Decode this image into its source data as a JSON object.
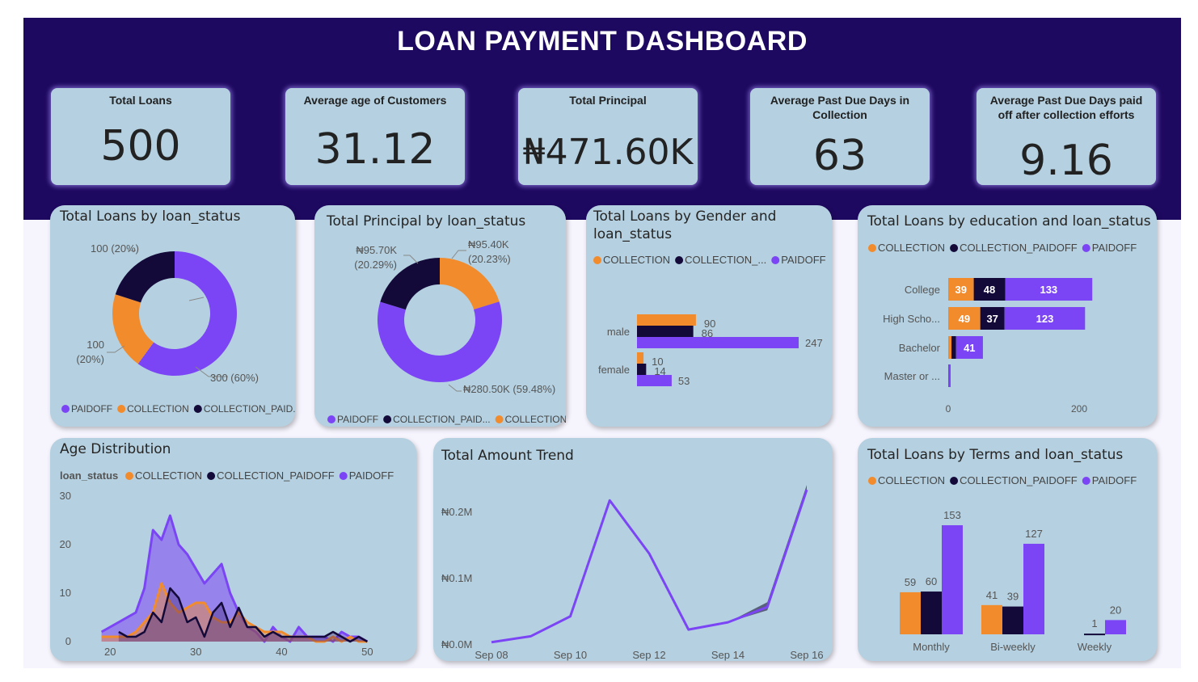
{
  "dashboard": {
    "title": "LOAN PAYMENT DASHBOARD"
  },
  "colors": {
    "paidoff": "#7b45f5",
    "collection": "#f28b2c",
    "collection_paidoff": "#130a3a",
    "card": "#b5d1e1",
    "header": "#1e0960"
  },
  "kpis": [
    {
      "label": "Total Loans",
      "value": "500"
    },
    {
      "label": "Average age of Customers",
      "value": "31.12"
    },
    {
      "label": "Total Principal",
      "value": "₦471.60K"
    },
    {
      "label": "Average Past Due Days in Collection",
      "value": "63"
    },
    {
      "label": "Average Past Due Days paid off after collection efforts",
      "value": "9.16"
    }
  ],
  "cards": {
    "loans_status": "Total Loans by loan_status",
    "principal_status": "Total Principal by loan_status",
    "gender": "Total Loans by Gender and loan_status",
    "education": "Total Loans by education and loan_status",
    "age": "Age Distribution",
    "trend": "Total Amount Trend",
    "terms": "Total Loans by Terms and loan_status"
  },
  "chart_data": [
    {
      "type": "pie",
      "title": "Total Loans by loan_status",
      "labels": [
        "PAIDOFF",
        "COLLECTION",
        "COLLECTION_PAIDOFF"
      ],
      "values": [
        300,
        100,
        100
      ],
      "data_labels": [
        "300 (60%)",
        "100",
        "(20%)",
        "100 (20%)"
      ],
      "legend": [
        "PAIDOFF",
        "COLLECTION",
        "COLLECTION_PAID..."
      ],
      "legend_position": "bottom"
    },
    {
      "type": "pie",
      "title": "Total Principal by loan_status",
      "labels": [
        "COLLECTION",
        "PAIDOFF",
        "COLLECTION_PAIDOFF"
      ],
      "values": [
        95400,
        280500,
        95700
      ],
      "data_labels": [
        "₦95.40K",
        "(20.23%)",
        "₦280.50K (59.48%)",
        "₦95.70K",
        "(20.29%)"
      ],
      "legend": [
        "PAIDOFF",
        "COLLECTION_PAID...",
        "COLLECTION"
      ],
      "legend_position": "bottom"
    },
    {
      "type": "bar",
      "orientation": "horizontal",
      "title": "Total Loans by Gender and loan_status",
      "legend": [
        "COLLECTION",
        "COLLECTION_...",
        "PAIDOFF"
      ],
      "legend_position": "top",
      "categories": [
        "male",
        "female"
      ],
      "series": [
        {
          "name": "COLLECTION",
          "values": [
            90,
            10
          ]
        },
        {
          "name": "COLLECTION_PAIDOFF",
          "values": [
            86,
            14
          ]
        },
        {
          "name": "PAIDOFF",
          "values": [
            247,
            53
          ]
        }
      ],
      "xlim": [
        0,
        260
      ]
    },
    {
      "type": "bar",
      "orientation": "horizontal",
      "stacked": true,
      "title": "Total Loans by education and loan_status",
      "legend": [
        "COLLECTION",
        "COLLECTION_PAIDOFF",
        "PAIDOFF"
      ],
      "legend_position": "top",
      "categories": [
        "College",
        "High Scho...",
        "Bachelor",
        "Master or ..."
      ],
      "series": [
        {
          "name": "COLLECTION",
          "values": [
            39,
            49,
            5,
            0
          ],
          "labels": [
            "39",
            "49",
            "",
            ""
          ]
        },
        {
          "name": "COLLECTION_PAIDOFF",
          "values": [
            48,
            37,
            7,
            0
          ],
          "labels": [
            "48",
            "37",
            "",
            ""
          ]
        },
        {
          "name": "PAIDOFF",
          "values": [
            133,
            123,
            41,
            2
          ],
          "labels": [
            "133",
            "123",
            "41",
            ""
          ]
        }
      ],
      "xticks": [
        "0",
        "200"
      ],
      "xlim": [
        0,
        260
      ]
    },
    {
      "type": "area",
      "title": "Age Distribution",
      "legend_title": "loan_status",
      "legend": [
        "COLLECTION",
        "COLLECTION_PAIDOFF",
        "PAIDOFF"
      ],
      "legend_position": "top-left",
      "xticks": [
        "20",
        "30",
        "40",
        "50"
      ],
      "yticks": [
        "0",
        "10",
        "20",
        "30"
      ],
      "xlim": [
        18,
        51
      ],
      "ylim": [
        0,
        30
      ],
      "series": [
        {
          "name": "PAIDOFF",
          "x": [
            19,
            21,
            23,
            24,
            25,
            26,
            27,
            28,
            29,
            30,
            31,
            32,
            33,
            34,
            35,
            36,
            37,
            38,
            39,
            40,
            41,
            42,
            43,
            44,
            45,
            46,
            47,
            48,
            49,
            50
          ],
          "y": [
            2,
            4,
            6,
            11,
            23,
            21,
            26,
            20,
            18,
            15,
            12,
            14,
            16,
            10,
            6,
            3,
            2,
            0,
            3,
            1,
            0,
            3,
            1,
            1,
            1,
            0,
            2,
            1,
            1,
            0
          ]
        },
        {
          "name": "COLLECTION",
          "x": [
            19,
            20,
            21,
            22,
            23,
            24,
            25,
            26,
            27,
            28,
            29,
            30,
            31,
            32,
            33,
            34,
            35,
            36,
            37,
            38,
            39,
            40,
            41,
            42,
            43,
            44,
            45,
            46,
            47,
            48,
            49,
            50
          ],
          "y": [
            1,
            1,
            1,
            1,
            2,
            4,
            6,
            12,
            8,
            6,
            7,
            8,
            8,
            5,
            4,
            4,
            6,
            4,
            3,
            2,
            2,
            2,
            1,
            1,
            1,
            0,
            0,
            1,
            0,
            1,
            0,
            0
          ]
        },
        {
          "name": "COLLECTION_PAIDOFF",
          "x": [
            21,
            22,
            23,
            24,
            25,
            26,
            27,
            28,
            29,
            30,
            31,
            32,
            33,
            34,
            35,
            36,
            37,
            38,
            39,
            40,
            41,
            42,
            43,
            44,
            45,
            46,
            47,
            48,
            49,
            50
          ],
          "y": [
            2,
            1,
            1,
            2,
            6,
            4,
            11,
            9,
            4,
            5,
            1,
            6,
            8,
            3,
            7,
            3,
            3,
            1,
            2,
            1,
            1,
            1,
            1,
            1,
            1,
            2,
            1,
            0,
            1,
            0
          ]
        }
      ]
    },
    {
      "type": "line",
      "title": "Total Amount Trend",
      "x": [
        "Sep 08",
        "Sep 09",
        "Sep 10",
        "Sep 11",
        "Sep 12",
        "Sep 13",
        "Sep 14",
        "Sep 15",
        "Sep 16"
      ],
      "xticks": [
        "Sep 08",
        "Sep 10",
        "Sep 12",
        "Sep 14",
        "Sep 16"
      ],
      "yticks": [
        "₦0.0M",
        "₦0.1M",
        "₦0.2M"
      ],
      "ylim": [
        0,
        0.25
      ],
      "series": [
        {
          "name": "Total Amount",
          "values": [
            0.004,
            0.013,
            0.043,
            0.218,
            0.138,
            0.023,
            0.034,
            0.057,
            0.234
          ]
        }
      ]
    },
    {
      "type": "bar",
      "title": "Total Loans by Terms and loan_status",
      "legend": [
        "COLLECTION",
        "COLLECTION_PAIDOFF",
        "PAIDOFF"
      ],
      "legend_position": "top",
      "categories": [
        "Monthly",
        "Bi-weekly",
        "Weekly"
      ],
      "series": [
        {
          "name": "COLLECTION",
          "values": [
            59,
            41,
            0
          ],
          "labels": [
            "59",
            "41",
            ""
          ]
        },
        {
          "name": "COLLECTION_PAIDOFF",
          "values": [
            60,
            39,
            1
          ],
          "labels": [
            "60",
            "39",
            "1"
          ]
        },
        {
          "name": "PAIDOFF",
          "values": [
            153,
            127,
            20
          ],
          "labels": [
            "153",
            "127",
            "20"
          ]
        }
      ],
      "ylim": [
        0,
        165
      ]
    }
  ]
}
